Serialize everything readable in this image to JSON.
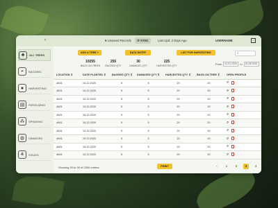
{
  "topbar": {
    "unsaved": "Unsaved Records",
    "unsaved_count": "5",
    "sync_label": "SYNC",
    "last_update": "Last Upd: 2 Days Ago",
    "username": "USERNAME"
  },
  "sidebar": {
    "items": [
      {
        "label": "ALL TREES",
        "icon": "tree-icon"
      },
      {
        "label": "BAGGING",
        "icon": "bag-icon"
      },
      {
        "label": "HARVESTING",
        "icon": "fruit-icon"
      },
      {
        "label": "FERTILIZING",
        "icon": "fertilizer-icon"
      },
      {
        "label": "SPRAYING",
        "icon": "spray-icon"
      },
      {
        "label": "DAMAGED",
        "icon": "damaged-fruit-icon"
      },
      {
        "label": "ISSUES",
        "icon": "issue-icon"
      }
    ]
  },
  "toolbar": {
    "add_tree": "ADD A TREE +",
    "data_entry": "DATA ENTRY",
    "list_harvesting": "LIST FOR HARVESTING",
    "search_placeholder": ""
  },
  "stats": [
    {
      "value": "10255",
      "label": "BAGS ON TREES"
    },
    {
      "value": "255",
      "label": "BAGGED QTY"
    },
    {
      "value": "30",
      "label": "DAMAGED QTY"
    },
    {
      "value": "225",
      "label": "HARVESTED QTY"
    }
  ],
  "filter": {
    "from_label": "From",
    "from": "01.01.2020",
    "to_label": "to",
    "to": "01.05.2020"
  },
  "table": {
    "columns": [
      "LOCATION",
      "DATE PLANTED",
      "BAGGED QTY",
      "DAMAGED QTY",
      "HARVESTED QTY",
      "BAGS ON TREE",
      "OPEN PROFILE"
    ],
    "rows": [
      [
        "4A01",
        "10.12.2020",
        "5",
        "5",
        "20",
        "20"
      ],
      [
        "4A01",
        "10.12.2020",
        "5",
        "5",
        "20",
        "20"
      ],
      [
        "4A01",
        "10.12.2020",
        "5",
        "5",
        "20",
        "20"
      ],
      [
        "4A01",
        "10.12.2020",
        "5",
        "5",
        "20",
        "20"
      ],
      [
        "4A01",
        "10.12.2020",
        "5",
        "5",
        "20",
        "20"
      ],
      [
        "4A01",
        "10.12.2020",
        "5",
        "5",
        "20",
        "20"
      ],
      [
        "4A01",
        "10.12.2020",
        "5",
        "5",
        "20",
        "20"
      ],
      [
        "4A01",
        "10.12.2020",
        "5",
        "5",
        "20",
        "20"
      ],
      [
        "4A01",
        "10.12.2020",
        "5",
        "5",
        "20",
        "20"
      ],
      [
        "4A01",
        "10.12.2020",
        "5",
        "5",
        "20",
        "20"
      ]
    ]
  },
  "footer": {
    "showing": "Showing 20 to 30 of 2000 entries",
    "print": "PRINT",
    "pages": [
      "1",
      "2",
      "3",
      "4",
      "5"
    ],
    "current_page": "3",
    "prev": "‹",
    "next": "›"
  },
  "colors": {
    "accent": "#f2c12e",
    "panel": "#eef1e8"
  }
}
